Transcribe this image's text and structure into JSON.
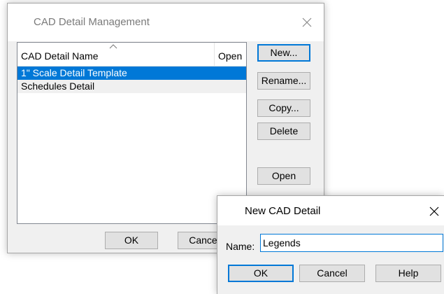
{
  "main_dialog": {
    "title": "CAD Detail Management",
    "columns": [
      "CAD Detail Name",
      "Open"
    ],
    "rows": [
      {
        "name": "1\" Scale Detail Template",
        "open": ""
      },
      {
        "name": "Schedules Detail",
        "open": ""
      }
    ],
    "buttons": {
      "new": "New...",
      "rename": "Rename...",
      "copy": "Copy...",
      "delete": "Delete",
      "open": "Open",
      "ok": "OK",
      "cancel": "Cancel"
    }
  },
  "sub_dialog": {
    "title": "New CAD Detail",
    "name_label": "Name:",
    "name_value": "Legends",
    "buttons": {
      "ok": "OK",
      "cancel": "Cancel",
      "help": "Help"
    }
  },
  "colors": {
    "selection": "#0078d7",
    "dialog_bg": "#f0f0f0",
    "button_bg": "#e1e1e1"
  },
  "icons": [
    "close-icon",
    "sort-ascending-icon"
  ]
}
